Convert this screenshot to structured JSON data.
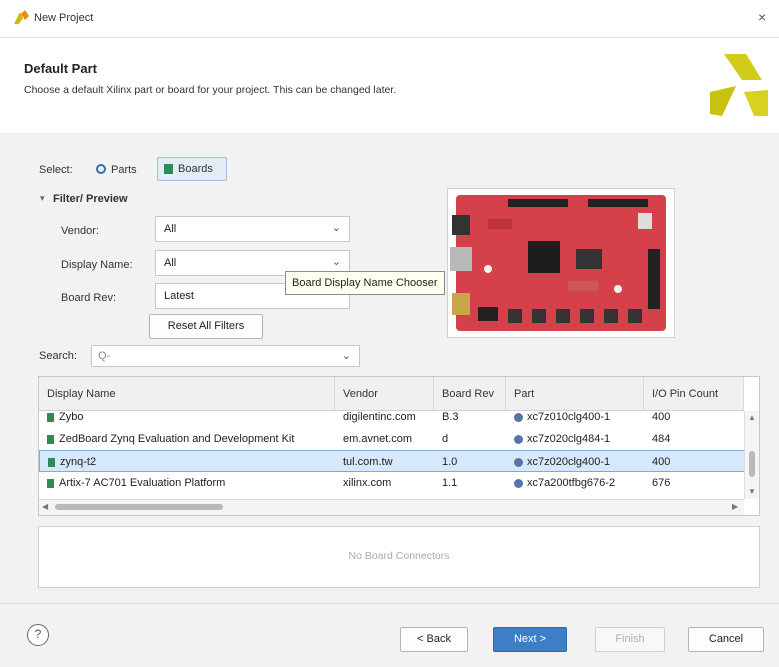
{
  "window": {
    "title": "New Project",
    "close_glyph": "×"
  },
  "header": {
    "title": "Default Part",
    "subtitle": "Choose a default Xilinx part or board for your project. This can be changed later."
  },
  "select": {
    "label": "Select:",
    "options": [
      {
        "label": "Parts",
        "selected": false
      },
      {
        "label": "Boards",
        "selected": true
      }
    ]
  },
  "filter": {
    "section_title": "Filter/ Preview",
    "vendor": {
      "label": "Vendor:",
      "value": "All"
    },
    "display_name": {
      "label": "Display Name:",
      "value": "All"
    },
    "board_rev": {
      "label": "Board Rev:",
      "value": "Latest"
    },
    "reset_label": "Reset All Filters"
  },
  "tooltip": {
    "text": "Board Display Name Chooser"
  },
  "search": {
    "label": "Search:",
    "placeholder": "Q-"
  },
  "table": {
    "columns": [
      "Display Name",
      "Vendor",
      "Board Rev",
      "Part",
      "I/O Pin Count"
    ],
    "rows": [
      {
        "name": "Zybo",
        "vendor": "digilentinc.com",
        "rev": "B.3",
        "part": "xc7z010clg400-1",
        "io": "400",
        "selected": false
      },
      {
        "name": "ZedBoard Zynq Evaluation and Development Kit",
        "vendor": "em.avnet.com",
        "rev": "d",
        "part": "xc7z020clg484-1",
        "io": "484",
        "selected": false
      },
      {
        "name": "zynq-t2",
        "vendor": "tul.com.tw",
        "rev": "1.0",
        "part": "xc7z020clg400-1",
        "io": "400",
        "selected": true
      },
      {
        "name": "Artix-7 AC701 Evaluation Platform",
        "vendor": "xilinx.com",
        "rev": "1.1",
        "part": "xc7a200tfbg676-2",
        "io": "676",
        "selected": false
      }
    ]
  },
  "connectors": {
    "empty_text": "No Board Connectors"
  },
  "footer": {
    "help": "?",
    "back": "< Back",
    "next": "Next >",
    "finish": "Finish",
    "cancel": "Cancel"
  },
  "colors": {
    "accent": "#3c7fc6",
    "selection": "#d6e8fb",
    "board_red": "#d4414a",
    "logo_yellow": "#c8c410"
  }
}
